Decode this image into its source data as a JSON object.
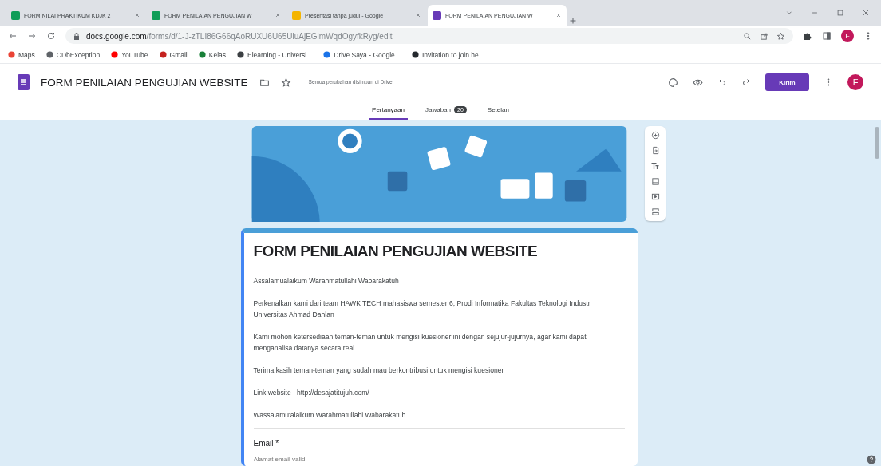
{
  "browser": {
    "tabs": [
      {
        "title": "FORM NILAI PRAKTIKUM KDJK 2",
        "kind": "sheets",
        "selected": false
      },
      {
        "title": "FORM PENILAIAN PENGUJIAN W",
        "kind": "sheets",
        "selected": false
      },
      {
        "title": "Presentasi tanpa judul - Google",
        "kind": "slides",
        "selected": false
      },
      {
        "title": "FORM PENILAIAN PENGUJIAN W",
        "kind": "forms",
        "selected": true
      }
    ],
    "url_host": "docs.google.com",
    "url_path": "/forms/d/1-J-zTLI86G66qAoRUXU6U65UluAjEGimWqdOgyfkRyg/edit",
    "profile": "F",
    "bookmarks": [
      {
        "label": "Maps",
        "kind": "maps"
      },
      {
        "label": "CDbException",
        "kind": "globe"
      },
      {
        "label": "YouTube",
        "kind": "youtube"
      },
      {
        "label": "Gmail",
        "kind": "gmail"
      },
      {
        "label": "Kelas",
        "kind": "classroom"
      },
      {
        "label": "Elearning - Universi...",
        "kind": "elearning"
      },
      {
        "label": "Drive Saya - Google...",
        "kind": "drive"
      },
      {
        "label": "Invitation to join he...",
        "kind": "github"
      }
    ]
  },
  "form_header": {
    "title": "FORM PENILAIAN PENGUJIAN WEBSITE",
    "save_status": "Semua perubahan disimpan di Drive",
    "send_button": "Kirim",
    "avatar": "F"
  },
  "view_tabs": [
    {
      "label": "Pertanyaan",
      "selected": true
    },
    {
      "label": "Jawaban",
      "badge": "20",
      "selected": false
    },
    {
      "label": "Setelan",
      "selected": false
    }
  ],
  "form": {
    "title": "FORM PENILAIAN PENGUJIAN WEBSITE",
    "description": [
      "Assalamualaikum Warahmatullahi Wabarakatuh",
      "Perkenalkan kami dari team HAWK TECH mahasiswa semester 6, Prodi Informatika Fakultas Teknologi Industri Universitas Ahmad Dahlan",
      "Kami mohon ketersediaan teman-teman untuk mengisi kuesioner ini dengan sejujur-jujurnya, agar kami dapat menganalisa datanya secara real",
      "Terima kasih teman-teman yang sudah mau berkontribusi untuk mengisi kuesioner",
      "Link website : http://desajatitujuh.com/",
      "Wassalamu'alaikum Warahmatullahi Wabarakatuh"
    ],
    "question": {
      "label": "Email *",
      "placeholder": "Alamat email valid"
    }
  }
}
